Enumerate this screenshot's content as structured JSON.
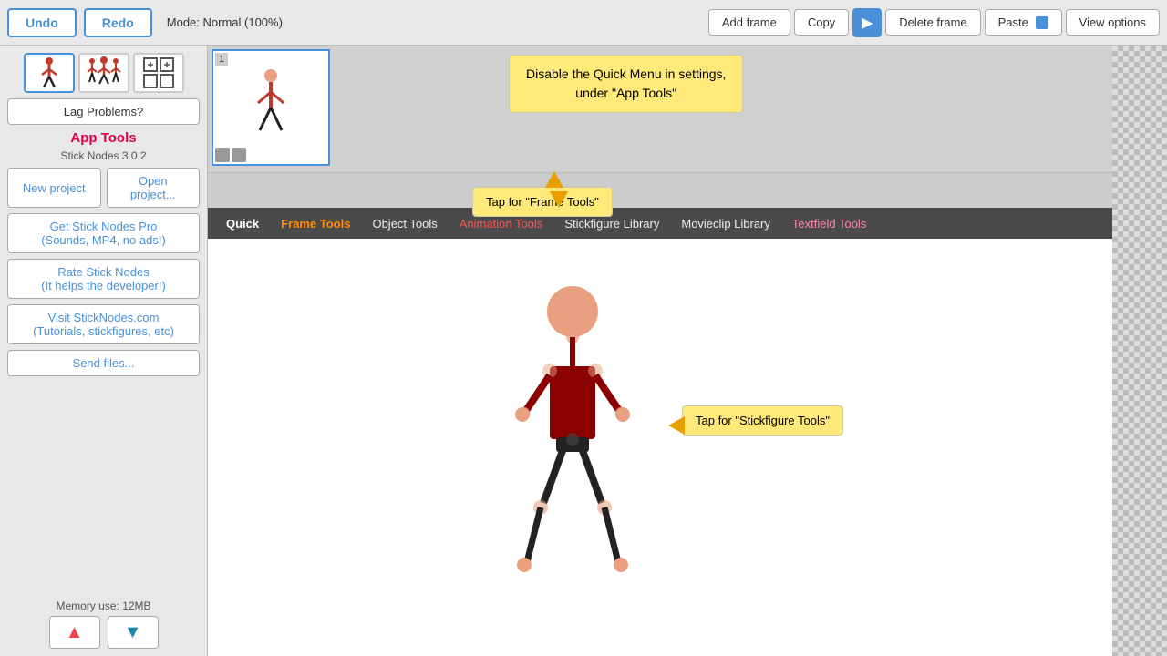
{
  "topbar": {
    "undo_label": "Undo",
    "redo_label": "Redo",
    "mode_label": "Mode: Normal (100%)",
    "add_frame_label": "Add frame",
    "copy_label": "Copy",
    "delete_frame_label": "Delete frame",
    "paste_label": "Paste",
    "view_options_label": "View options"
  },
  "sidebar": {
    "lag_label": "Lag Problems?",
    "app_tools_title": "App Tools",
    "version": "Stick Nodes 3.0.2",
    "new_project_label": "New project",
    "open_project_label": "Open\nproject...",
    "get_pro_label": "Get Stick Nodes Pro\n(Sounds, MP4, no ads!)",
    "rate_label": "Rate Stick Nodes\n(It helps the developer!)",
    "visit_label": "Visit StickNodes.com\n(Tutorials, stickfigures, etc)",
    "send_files_label": "Send files...",
    "memory_label": "Memory use: 12MB"
  },
  "menu": {
    "items": [
      {
        "label": "Quick",
        "color": "normal"
      },
      {
        "label": "Frame Tools",
        "color": "tooltip"
      },
      {
        "label": "Object Tools",
        "color": "normal"
      },
      {
        "label": "Animation Tools",
        "color": "red"
      },
      {
        "label": "Stickfigure Library",
        "color": "normal"
      },
      {
        "label": "Movieclip Library",
        "color": "normal"
      },
      {
        "label": "Textfield Tools",
        "color": "normal"
      }
    ]
  },
  "tooltips": {
    "frame_tools": "Tap for \"Frame Tools\"",
    "quick_menu": "Disable the Quick Menu in settings,\nunder \"App Tools\"",
    "stickfigure_tools": "Tap for \"Stickfigure Tools\""
  },
  "frame": {
    "number": "1"
  },
  "icons": {
    "person_icon": "🚶",
    "group_icon": "👥",
    "grid_icon": "⊞",
    "arrow_up": "▲",
    "arrow_down": "▼",
    "play": "▶"
  }
}
